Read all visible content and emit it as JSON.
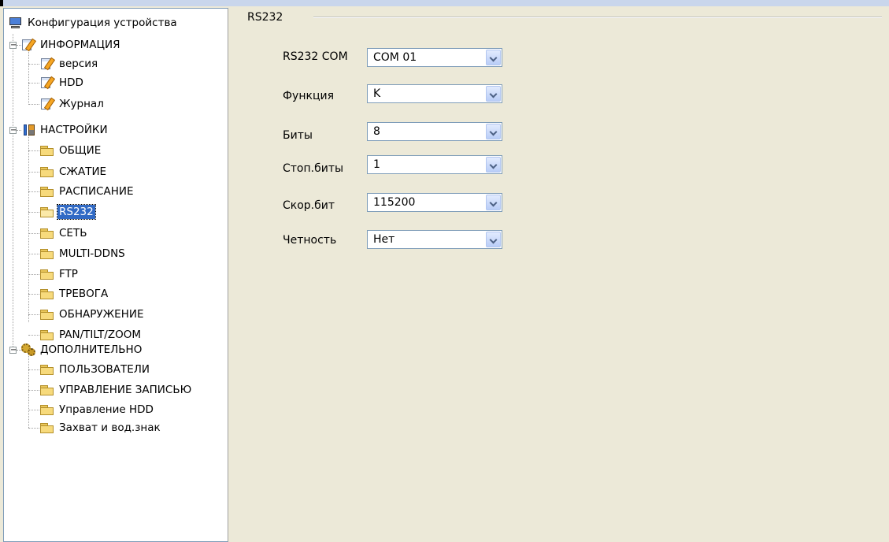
{
  "tree": {
    "root": {
      "label": "Конфигурация устройства",
      "icon": "computer-icon"
    },
    "groups": [
      {
        "label": "ИНФОРМАЦИЯ",
        "icon": "notepad-icon",
        "children": [
          "версия",
          "HDD",
          "Журнал"
        ]
      },
      {
        "label": "НАСТРОЙКИ",
        "icon": "tools-icon",
        "children": [
          "ОБЩИЕ",
          "СЖАТИЕ",
          "РАСПИСАНИЕ",
          "RS232",
          "СЕТЬ",
          "MULTI-DDNS",
          "FTP",
          "ТРЕВОГА",
          "ОБНАРУЖЕНИЕ",
          "PAN/TILT/ZOOM"
        ]
      },
      {
        "label": "ДОПОЛНИТЕЛЬНО",
        "icon": "gears-icon",
        "children": [
          "ПОЛЬЗОВАТЕЛИ",
          "УПРАВЛЕНИЕ ЗАПИСЬЮ",
          "Управление HDD",
          "Захват и вод.знак"
        ]
      }
    ],
    "selected": "RS232",
    "expand_symbol": "−"
  },
  "panel": {
    "group_title": "RS232",
    "fields": [
      {
        "label": "RS232 COM",
        "value": "COM 01"
      },
      {
        "label": "Функция",
        "value": "K"
      },
      {
        "label": "Биты",
        "value": "8"
      },
      {
        "label": "Стоп.биты",
        "value": "1"
      },
      {
        "label": "Скор.бит",
        "value": "115200"
      },
      {
        "label": "Четность",
        "value": "Нет"
      }
    ]
  },
  "colors": {
    "background": "#ece9d8",
    "selection": "#316ac5",
    "border": "#7f9db9"
  }
}
